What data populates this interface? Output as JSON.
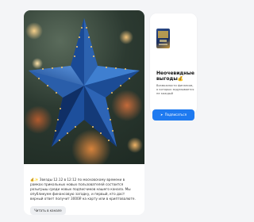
{
  "post": {
    "image_icon": "christmas-star-image",
    "text": "💰✨ Звезды 12.12 в 12:12 по московскому времени в рамках прикольных новых пользователей состоится розыгрыш среди новых подписчиков нашего канала. Мы опубликуем финансовую загадку, и первый, кто даст верный ответ получит 3000₽ на карту или в криптовалюте. Если вы собираетесь принять участие ...",
    "read_more_label": "Читать в канале"
  },
  "channel": {
    "thumb_icon": "channel-cover-image",
    "title": "Неочевидные выгоды💰",
    "description": "Возможности финансов, о которых задумывается не каждый",
    "subscribe_icon": "telegram-icon",
    "subscribe_label": "Подписаться"
  },
  "colors": {
    "accent": "#1e7af0",
    "star": "#1d4f9c",
    "page_bg": "#f4f5f7"
  }
}
